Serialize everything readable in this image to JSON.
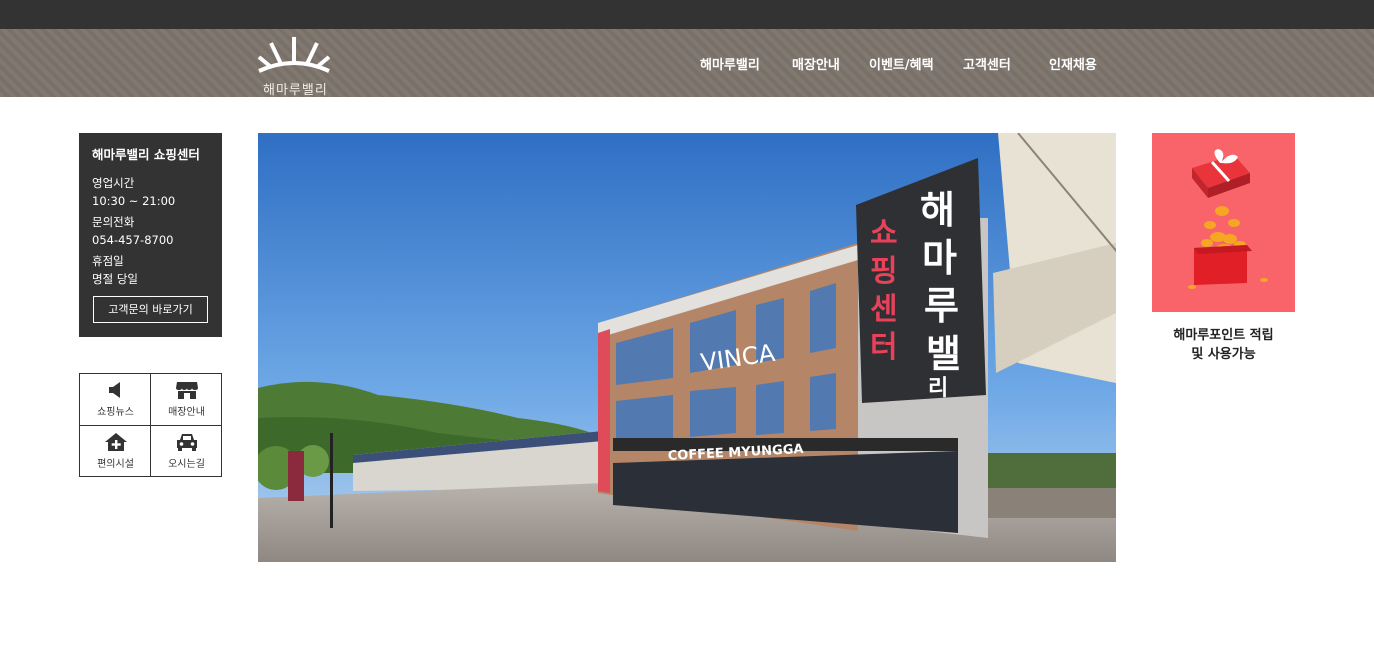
{
  "header": {
    "logo_text": "해마루밸리",
    "nav": [
      "해마루밸리",
      "매장안내",
      "이벤트/혜택",
      "고객센터",
      "인재채용"
    ]
  },
  "info_box": {
    "title": "해마루밸리 쇼핑센터",
    "hours_label": "영업시간",
    "hours_value": "10:30 ~ 21:00",
    "phone_label": "문의전화",
    "phone_value": "054-457-8700",
    "closed_label": "휴점일",
    "closed_value": "명절 당일",
    "button_label": "고객문의 바로가기"
  },
  "quick_links": [
    {
      "label": "쇼핑뉴스",
      "icon": "megaphone-icon"
    },
    {
      "label": "매장안내",
      "icon": "store-icon"
    },
    {
      "label": "편의시설",
      "icon": "home-plus-icon"
    },
    {
      "label": "오시는길",
      "icon": "car-icon"
    }
  ],
  "hero": {
    "sign_vertical_big": "해마루밸리",
    "sign_vertical_red": "쇼핑센터",
    "sign_vinca": "VINCA",
    "sign_coffee": "COFFEE MYUNGGA"
  },
  "promo": {
    "caption_line1": "해마루포인트 적립",
    "caption_line2": "및 사용가능"
  },
  "colors": {
    "topbar": "#333333",
    "header": "#7d746c",
    "info_box": "#333333",
    "promo_bg": "#f8646a"
  }
}
